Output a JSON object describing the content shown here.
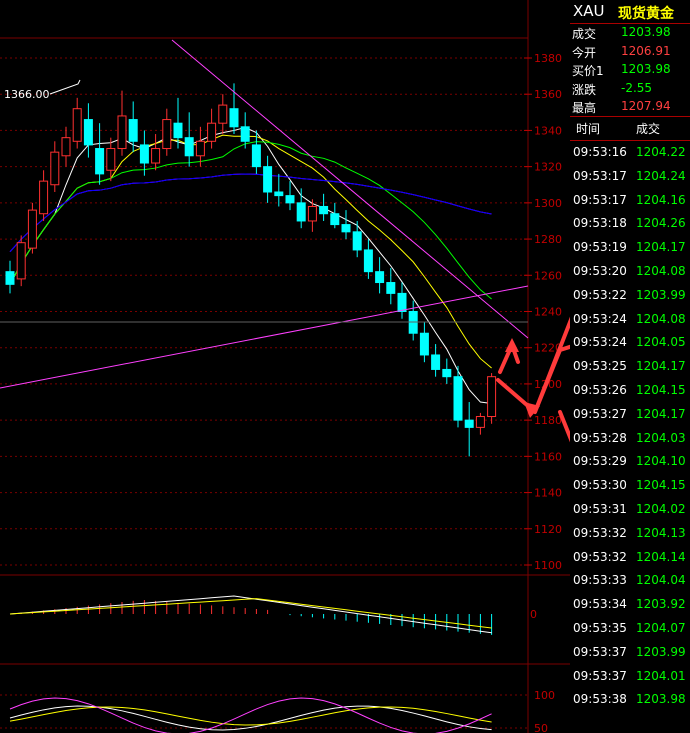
{
  "chart": {
    "peak_label": "1366.00",
    "price_axis": [
      "1380",
      "1360",
      "1340",
      "1320",
      "1300",
      "1280",
      "1260",
      "1240",
      "1220",
      "1200",
      "1180",
      "1160",
      "1140",
      "1120",
      "1100"
    ],
    "macd_axis": [
      "0"
    ],
    "kdj_axis": [
      "100",
      "50"
    ]
  },
  "chart_data": {
    "type": "candlestick",
    "ylim": [
      1100,
      1390
    ],
    "candles": [
      [
        1262,
        1268,
        1250,
        1255
      ],
      [
        1258,
        1282,
        1254,
        1278
      ],
      [
        1275,
        1300,
        1272,
        1296
      ],
      [
        1294,
        1318,
        1290,
        1312
      ],
      [
        1310,
        1334,
        1306,
        1328
      ],
      [
        1326,
        1342,
        1320,
        1336
      ],
      [
        1334,
        1358,
        1330,
        1352
      ],
      [
        1346,
        1355,
        1325,
        1332
      ],
      [
        1330,
        1344,
        1310,
        1316
      ],
      [
        1318,
        1336,
        1312,
        1330
      ],
      [
        1330,
        1362,
        1326,
        1348
      ],
      [
        1346,
        1356,
        1328,
        1334
      ],
      [
        1332,
        1340,
        1315,
        1322
      ],
      [
        1322,
        1338,
        1318,
        1330
      ],
      [
        1330,
        1352,
        1326,
        1346
      ],
      [
        1344,
        1358,
        1330,
        1336
      ],
      [
        1336,
        1350,
        1320,
        1326
      ],
      [
        1326,
        1342,
        1320,
        1334
      ],
      [
        1334,
        1352,
        1330,
        1344
      ],
      [
        1344,
        1360,
        1338,
        1354
      ],
      [
        1352,
        1366,
        1338,
        1342
      ],
      [
        1342,
        1350,
        1330,
        1334
      ],
      [
        1332,
        1340,
        1316,
        1320
      ],
      [
        1320,
        1326,
        1300,
        1306
      ],
      [
        1306,
        1316,
        1298,
        1304
      ],
      [
        1304,
        1312,
        1296,
        1300
      ],
      [
        1300,
        1308,
        1286,
        1290
      ],
      [
        1290,
        1302,
        1284,
        1298
      ],
      [
        1298,
        1305,
        1290,
        1294
      ],
      [
        1294,
        1300,
        1286,
        1288
      ],
      [
        1288,
        1296,
        1280,
        1284
      ],
      [
        1284,
        1290,
        1270,
        1274
      ],
      [
        1274,
        1280,
        1258,
        1262
      ],
      [
        1262,
        1270,
        1250,
        1256
      ],
      [
        1256,
        1264,
        1244,
        1250
      ],
      [
        1250,
        1256,
        1236,
        1240
      ],
      [
        1240,
        1246,
        1224,
        1228
      ],
      [
        1228,
        1234,
        1212,
        1216
      ],
      [
        1216,
        1222,
        1204,
        1208
      ],
      [
        1208,
        1214,
        1200,
        1204
      ],
      [
        1204,
        1210,
        1176,
        1180
      ],
      [
        1180,
        1190,
        1160,
        1176
      ],
      [
        1176,
        1184,
        1172,
        1182
      ],
      [
        1182,
        1206,
        1178,
        1204
      ]
    ],
    "ma_series": [
      {
        "color": "#ffffff"
      },
      {
        "color": "#ffff00"
      },
      {
        "color": "#00ff00"
      },
      {
        "color": "#ff00ff"
      },
      {
        "color": "#0000ff"
      }
    ]
  },
  "quote": {
    "symbol": "XAU",
    "name": "现货黄金",
    "rows": [
      {
        "label": "成交",
        "value": "1203.98",
        "color": "#00ff00"
      },
      {
        "label": "今开",
        "value": "1206.91",
        "color": "#ff4040"
      },
      {
        "label": "买价1",
        "value": "1203.98",
        "color": "#00ff00"
      },
      {
        "label": "涨跌",
        "value": "-2.55",
        "color": "#00ff00"
      },
      {
        "label": "最高",
        "value": "1207.94",
        "color": "#ff4040"
      }
    ]
  },
  "ticks": {
    "header_time": "时间",
    "header_price": "成交",
    "rows": [
      {
        "time": "09:53:16",
        "price": "1204.22"
      },
      {
        "time": "09:53:17",
        "price": "1204.24"
      },
      {
        "time": "09:53:17",
        "price": "1204.16"
      },
      {
        "time": "09:53:18",
        "price": "1204.26"
      },
      {
        "time": "09:53:19",
        "price": "1204.17"
      },
      {
        "time": "09:53:20",
        "price": "1204.08"
      },
      {
        "time": "09:53:22",
        "price": "1203.99"
      },
      {
        "time": "09:53:24",
        "price": "1204.08"
      },
      {
        "time": "09:53:24",
        "price": "1204.05"
      },
      {
        "time": "09:53:25",
        "price": "1204.17"
      },
      {
        "time": "09:53:26",
        "price": "1204.15"
      },
      {
        "time": "09:53:27",
        "price": "1204.17"
      },
      {
        "time": "09:53:28",
        "price": "1204.03"
      },
      {
        "time": "09:53:29",
        "price": "1204.10"
      },
      {
        "time": "09:53:30",
        "price": "1204.15"
      },
      {
        "time": "09:53:31",
        "price": "1204.02"
      },
      {
        "time": "09:53:32",
        "price": "1204.13"
      },
      {
        "time": "09:53:32",
        "price": "1204.14"
      },
      {
        "time": "09:53:33",
        "price": "1204.04"
      },
      {
        "time": "09:53:34",
        "price": "1203.92"
      },
      {
        "time": "09:53:35",
        "price": "1204.07"
      },
      {
        "time": "09:53:37",
        "price": "1203.99"
      },
      {
        "time": "09:53:37",
        "price": "1204.01"
      },
      {
        "time": "09:53:38",
        "price": "1203.98"
      }
    ]
  },
  "colors": {
    "up": "#ff3030",
    "down": "#00ffff",
    "grid": "#7a0000",
    "axis_text": "#c00000",
    "annotation": "#ff3b3b"
  }
}
